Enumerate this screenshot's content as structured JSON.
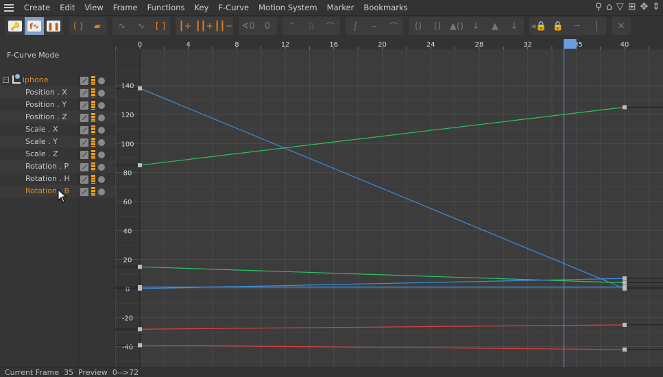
{
  "menu": [
    "Create",
    "Edit",
    "View",
    "Frame",
    "Functions",
    "Key",
    "F-Curve",
    "Motion System",
    "Marker",
    "Bookmarks"
  ],
  "right_icons": [
    "search-icon",
    "home-icon",
    "filter-icon",
    "add-icon",
    "move-icon",
    "scale-vertical-icon"
  ],
  "right_glyphs": [
    "⚲",
    "⌂",
    "▽",
    "⊞",
    "✥",
    "⇕"
  ],
  "toolbar": [
    {
      "icons": [
        {
          "name": "key-mode-icon",
          "g": "🔑",
          "style": "white"
        },
        {
          "name": "fcurve-mode-icon",
          "g": "f∿",
          "style": "white sel"
        },
        {
          "name": "dopesheet-mode-icon",
          "g": "❚❚",
          "style": "white"
        }
      ]
    },
    {
      "icons": [
        {
          "name": "loop-icon",
          "g": "( )",
          "style": "on"
        },
        {
          "name": "folder-icon",
          "g": "▰",
          "style": "on"
        }
      ]
    },
    {
      "icons": [
        {
          "name": "curve-frame-icon",
          "g": "∿",
          "style": ""
        },
        {
          "name": "curve-disabled-icon",
          "g": "∿",
          "style": ""
        },
        {
          "name": "frame-bracket-icon",
          "g": "[ ]",
          "style": "on"
        }
      ]
    },
    {
      "icons": [
        {
          "name": "add-key-icon",
          "g": "┃+",
          "style": "on"
        },
        {
          "name": "add-keys-icon",
          "g": "┃┃+",
          "style": "on"
        },
        {
          "name": "remove-keys-icon",
          "g": "┃┃−",
          "style": "on"
        }
      ]
    },
    {
      "icons": [
        {
          "name": "zero-angle-icon",
          "g": "∢0",
          "style": ""
        },
        {
          "name": "zero-length-icon",
          "g": "0",
          "style": ""
        }
      ]
    },
    {
      "icons": [
        {
          "name": "linear-icon",
          "g": "⌃",
          "style": ""
        },
        {
          "name": "step-icon",
          "g": "⎍",
          "style": ""
        },
        {
          "name": "spline-icon",
          "g": "⌒",
          "style": ""
        }
      ]
    },
    {
      "icons": [
        {
          "name": "ease-ease-icon",
          "g": "∫",
          "style": ""
        },
        {
          "name": "ease-in-icon",
          "g": "⌣",
          "style": ""
        },
        {
          "name": "ease-out-icon",
          "g": "⌒",
          "style": ""
        }
      ]
    },
    {
      "icons": [
        {
          "name": "tangent-lock-icon",
          "g": "()",
          "style": ""
        },
        {
          "name": "tangent-unlock-icon",
          "g": "()",
          "style": ""
        },
        {
          "name": "weight-lock-icon",
          "g": "▲()",
          "style": ""
        },
        {
          "name": "break-tangent-icon",
          "g": "↓",
          "style": ""
        },
        {
          "name": "weight-icon",
          "g": "▲",
          "style": ""
        },
        {
          "name": "auto-tangent-icon",
          "g": "↓",
          "style": ""
        }
      ]
    },
    {
      "icons": [
        {
          "name": "lock-key-icon",
          "g": "◂🔒",
          "style": ""
        },
        {
          "name": "lock-time-icon",
          "g": "🔒",
          "style": ""
        },
        {
          "name": "lock-value-h-icon",
          "g": "─",
          "style": ""
        },
        {
          "name": "lock-value-v-icon",
          "g": "│",
          "style": ""
        }
      ]
    },
    {
      "icons": [
        {
          "name": "mute-icon",
          "g": "✕",
          "style": ""
        }
      ]
    }
  ],
  "left_panel": {
    "mode": "F-Curve Mode",
    "object": "iphone",
    "tracks": [
      "Position . X",
      "Position . Y",
      "Position . Z",
      "Scale . X",
      "Scale . Y",
      "Scale . Z",
      "Rotation . P",
      "Rotation . H",
      "Rotation . B"
    ],
    "selected_track": "Rotation . B"
  },
  "status": {
    "label": "Current Frame",
    "frame": "35",
    "preview_label": "Preview",
    "preview": "0-->72"
  },
  "chart_data": {
    "type": "line",
    "x_ticks": [
      0,
      4,
      8,
      12,
      16,
      20,
      24,
      28,
      32,
      36,
      40
    ],
    "x_tick_labels": [
      "0",
      "4",
      "8",
      "12",
      "16",
      "20",
      "24",
      "28",
      "32",
      "635",
      "40"
    ],
    "y_ticks": [
      140,
      120,
      100,
      80,
      60,
      40,
      20,
      0,
      -20,
      -40
    ],
    "xlim": [
      -2,
      43
    ],
    "ylim": [
      -48,
      152
    ],
    "current_frame": 35,
    "grid": true,
    "colors": {
      "blue": "#3a8fe0",
      "green": "#30c060",
      "red": "#e04040",
      "key": "#bbbbbb",
      "cursor": "#6a9de0"
    },
    "series": [
      {
        "color": "blue",
        "x": [
          0,
          40
        ],
        "values": [
          138,
          0
        ]
      },
      {
        "color": "green",
        "x": [
          0,
          40
        ],
        "values": [
          85,
          125
        ]
      },
      {
        "color": "green",
        "x": [
          0,
          40
        ],
        "values": [
          15,
          4
        ]
      },
      {
        "color": "blue",
        "x": [
          0,
          40
        ],
        "values": [
          0,
          7
        ]
      },
      {
        "color": "blue",
        "x": [
          0,
          40
        ],
        "values": [
          1,
          1
        ]
      },
      {
        "color": "red",
        "x": [
          0,
          40
        ],
        "values": [
          -28,
          -25
        ]
      },
      {
        "color": "red",
        "x": [
          0,
          40
        ],
        "values": [
          -39,
          -42
        ]
      }
    ]
  }
}
